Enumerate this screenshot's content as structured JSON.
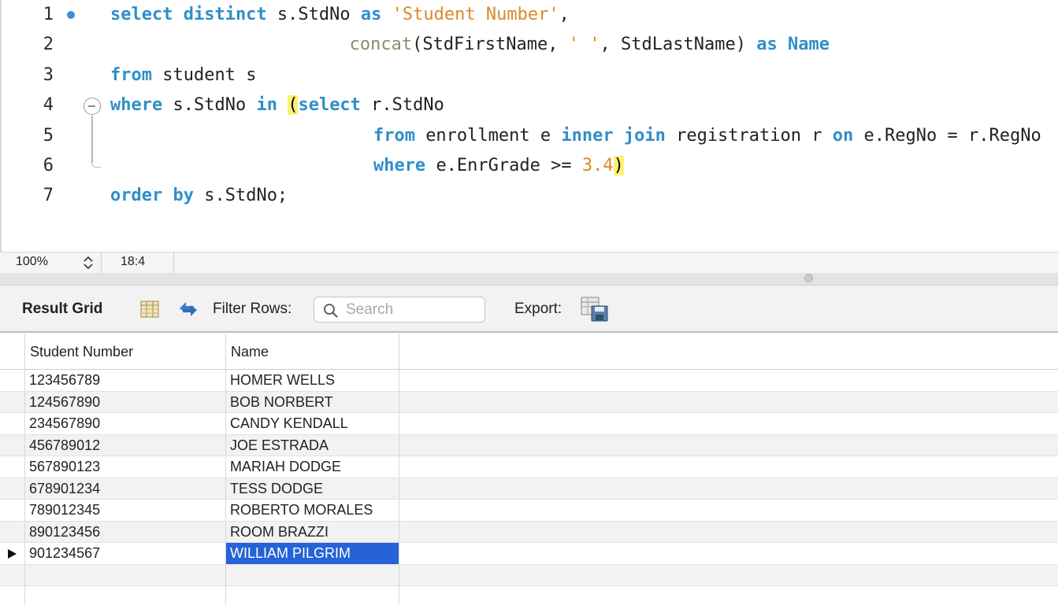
{
  "editor": {
    "lines": [
      {
        "n": "1",
        "tokens": [
          [
            "kw",
            "select distinct "
          ],
          [
            "id",
            "s.StdNo "
          ],
          [
            "kw",
            "as "
          ],
          [
            "str",
            "'Student Number'"
          ],
          [
            "id",
            ","
          ]
        ],
        "indent": 0
      },
      {
        "n": "2",
        "tokens": [
          [
            "fn",
            "concat"
          ],
          [
            "id",
            "(StdFirstName, "
          ],
          [
            "str",
            "' '"
          ],
          [
            "id",
            ", StdLastName) "
          ],
          [
            "kw",
            "as "
          ],
          [
            "kw",
            "Name"
          ]
        ],
        "indent": 10
      },
      {
        "n": "3",
        "tokens": [
          [
            "kw",
            "from "
          ],
          [
            "id",
            "student s"
          ]
        ],
        "indent": 0
      },
      {
        "n": "4",
        "tokens": [
          [
            "kw",
            "where "
          ],
          [
            "id",
            "s.StdNo "
          ],
          [
            "kw",
            "in "
          ],
          [
            "hl",
            "("
          ],
          [
            "kw",
            "select "
          ],
          [
            "id",
            "r.StdNo"
          ]
        ],
        "indent": 0
      },
      {
        "n": "5",
        "tokens": [
          [
            "kw",
            "from "
          ],
          [
            "id",
            "enrollment e "
          ],
          [
            "kw",
            "inner join "
          ],
          [
            "id",
            "registration r "
          ],
          [
            "kw",
            "on "
          ],
          [
            "id",
            "e.RegNo = r.RegNo"
          ]
        ],
        "indent": 11
      },
      {
        "n": "6",
        "tokens": [
          [
            "kw",
            "where "
          ],
          [
            "id",
            "e.EnrGrade >= "
          ],
          [
            "num",
            "3.4"
          ],
          [
            "hl",
            ")"
          ]
        ],
        "indent": 11
      },
      {
        "n": "7",
        "tokens": [
          [
            "kw",
            "order by "
          ],
          [
            "id",
            "s.StdNo;"
          ]
        ],
        "indent": 0
      }
    ]
  },
  "statusbar": {
    "zoom": "100%",
    "cursor": "18:4"
  },
  "toolbar": {
    "result_grid": "Result Grid",
    "filter_rows": "Filter Rows:",
    "search_placeholder": "Search",
    "export": "Export:"
  },
  "grid": {
    "columns": [
      "Student Number",
      "Name"
    ],
    "rows": [
      [
        "123456789",
        "HOMER WELLS"
      ],
      [
        "124567890",
        "BOB NORBERT"
      ],
      [
        "234567890",
        "CANDY KENDALL"
      ],
      [
        "456789012",
        "JOE ESTRADA"
      ],
      [
        "567890123",
        "MARIAH DODGE"
      ],
      [
        "678901234",
        "TESS DODGE"
      ],
      [
        "789012345",
        "ROBERTO MORALES"
      ],
      [
        "890123456",
        "ROOM BRAZZI"
      ],
      [
        "901234567",
        "WILLIAM PILGRIM"
      ]
    ],
    "selected_row": 8
  },
  "colors": {
    "keyword": "#2f8fc7",
    "string": "#d98a2b",
    "selection": "#2563d6",
    "bracket_highlight": "#fdf07a"
  }
}
